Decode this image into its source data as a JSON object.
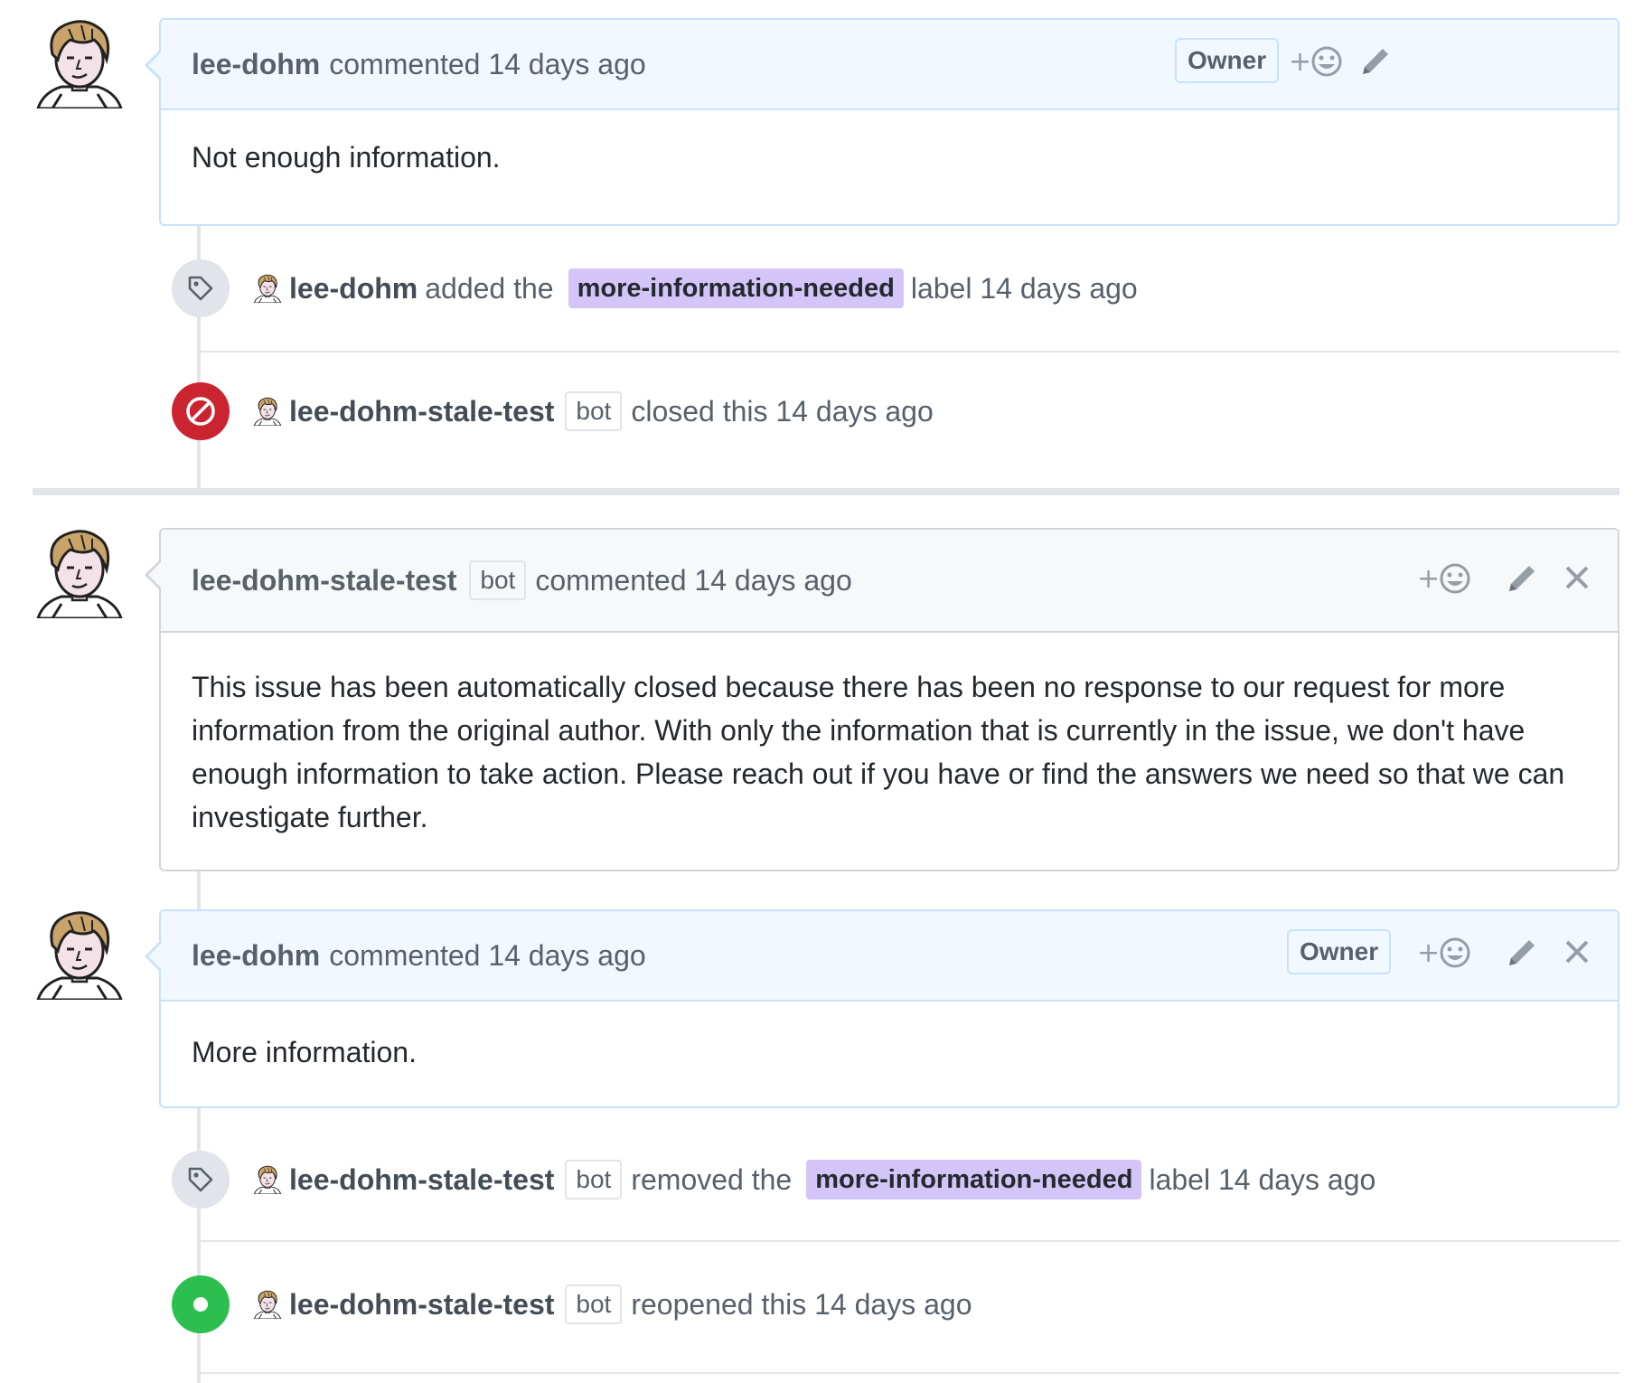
{
  "comments": [
    {
      "author": "lee-dohm",
      "action_text": "commented 14 days ago",
      "badge": "Owner",
      "body": "Not enough information."
    },
    {
      "author": "lee-dohm-stale-test",
      "bot_label": "bot",
      "action_text": "commented 14 days ago",
      "body": "This issue has been automatically closed because there has been no response to our request for more information from the original author. With only the information that is currently in the issue, we don't have enough information to take action. Please reach out if you have or find the answers we need so that we can investigate further."
    },
    {
      "author": "lee-dohm",
      "action_text": "commented 14 days ago",
      "badge": "Owner",
      "body": "More information."
    }
  ],
  "events": [
    {
      "actor": "lee-dohm",
      "verb": "added the",
      "label": "more-information-needed",
      "suffix": "label 14 days ago",
      "icon": "tag-icon"
    },
    {
      "actor": "lee-dohm-stale-test",
      "bot_label": "bot",
      "verb": "closed this 14 days ago",
      "icon": "circle-slash-icon"
    },
    {
      "actor": "lee-dohm-stale-test",
      "bot_label": "bot",
      "verb": "removed the",
      "label": "more-information-needed",
      "suffix": "label 14 days ago",
      "icon": "tag-icon"
    },
    {
      "actor": "lee-dohm-stale-test",
      "bot_label": "bot",
      "verb": "reopened this 14 days ago",
      "icon": "primitive-dot-icon"
    }
  ],
  "reaction_plus": "+",
  "colors": {
    "closed_red": "#cb2431",
    "open_green": "#2cbe4e",
    "label_purple": "#d4c5f9",
    "header_blue": "#f1f8ff",
    "header_gray": "#f6f8fa"
  }
}
